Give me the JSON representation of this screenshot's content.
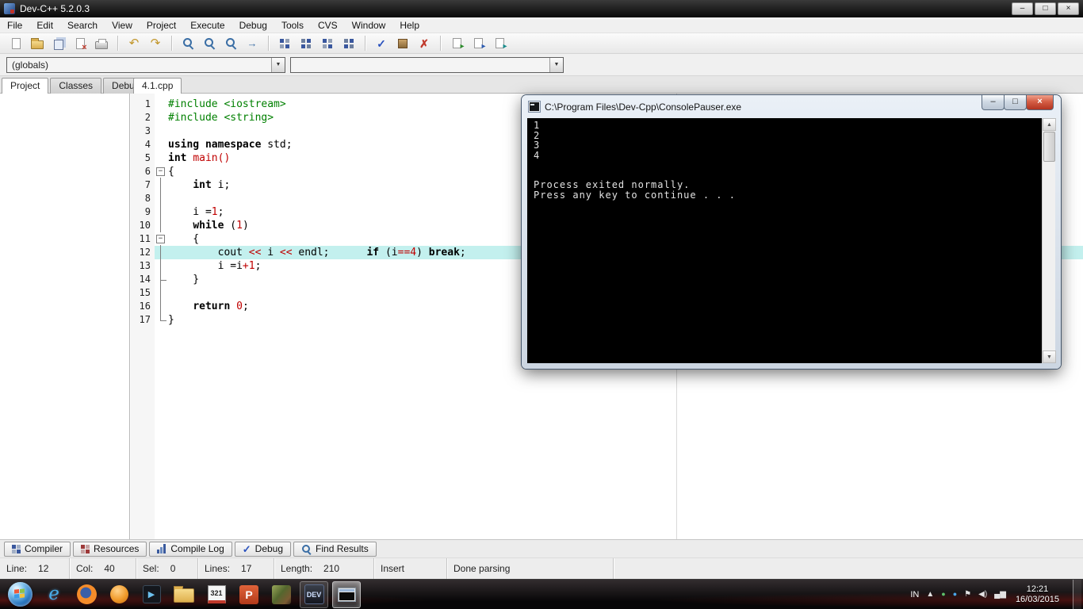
{
  "titlebar": {
    "title": "Dev-C++ 5.2.0.3"
  },
  "icons": {
    "minimize": "–",
    "maximize": "□",
    "close": "×",
    "dropdown": "▼",
    "scroll_up": "▲",
    "scroll_down": "▼",
    "undo": "↶",
    "redo": "↷",
    "check": "✓",
    "abort": "✗",
    "goto_line": "→",
    "fold_collapsed": "−",
    "play": "▶",
    "tray_chevron": "▲",
    "tray_volume": "◀)",
    "tray_network": "▄▆",
    "tray_flag": "⚑",
    "tray_dot": "●"
  },
  "menu": [
    "File",
    "Edit",
    "Search",
    "View",
    "Project",
    "Execute",
    "Debug",
    "Tools",
    "CVS",
    "Window",
    "Help"
  ],
  "navbar": {
    "globals": "(globals)",
    "members": ""
  },
  "panel_tabs": [
    "Project",
    "Classes",
    "Debug"
  ],
  "editor": {
    "tab": "4.1.cpp",
    "lines": [
      {
        "n": 1,
        "fold": "",
        "hl": false,
        "seg": [
          [
            "#include <iostream>",
            "g"
          ]
        ]
      },
      {
        "n": 2,
        "fold": "",
        "hl": false,
        "seg": [
          [
            "#include <string>",
            "g"
          ]
        ]
      },
      {
        "n": 3,
        "fold": "",
        "hl": false,
        "seg": []
      },
      {
        "n": 4,
        "fold": "",
        "hl": false,
        "seg": [
          [
            "using namespace",
            "k"
          ],
          [
            " std;",
            "p"
          ]
        ]
      },
      {
        "n": 5,
        "fold": "",
        "hl": false,
        "seg": [
          [
            "int",
            "k"
          ],
          [
            " ",
            "p"
          ],
          [
            "main()",
            "r"
          ]
        ]
      },
      {
        "n": 6,
        "fold": "box",
        "hl": false,
        "seg": [
          [
            "{",
            "p"
          ]
        ]
      },
      {
        "n": 7,
        "fold": "v",
        "hl": false,
        "seg": [
          [
            "    ",
            "p"
          ],
          [
            "int",
            "k"
          ],
          [
            " i;",
            "p"
          ]
        ]
      },
      {
        "n": 8,
        "fold": "v",
        "hl": false,
        "seg": []
      },
      {
        "n": 9,
        "fold": "v",
        "hl": false,
        "seg": [
          [
            "    i =",
            "p"
          ],
          [
            "1",
            "r"
          ],
          [
            ";",
            "p"
          ]
        ]
      },
      {
        "n": 10,
        "fold": "v",
        "hl": false,
        "seg": [
          [
            "    ",
            "p"
          ],
          [
            "while",
            "k"
          ],
          [
            " (",
            "p"
          ],
          [
            "1",
            "r"
          ],
          [
            ")",
            "p"
          ]
        ]
      },
      {
        "n": 11,
        "fold": "box",
        "hl": false,
        "seg": [
          [
            "    {",
            "p"
          ]
        ]
      },
      {
        "n": 12,
        "fold": "v",
        "hl": true,
        "seg": [
          [
            "        cout ",
            "p"
          ],
          [
            "<<",
            "r"
          ],
          [
            " i ",
            "p"
          ],
          [
            "<<",
            "r"
          ],
          [
            " endl;",
            "p"
          ],
          [
            "      ",
            "p"
          ],
          [
            "if",
            "k"
          ],
          [
            " (i",
            "p"
          ],
          [
            "==",
            "r"
          ],
          [
            "4",
            "r"
          ],
          [
            ") ",
            "p"
          ],
          [
            "break",
            "k"
          ],
          [
            ";",
            "p"
          ]
        ]
      },
      {
        "n": 13,
        "fold": "v",
        "hl": false,
        "seg": [
          [
            "        i =i",
            "p"
          ],
          [
            "+",
            "r"
          ],
          [
            "1",
            "r"
          ],
          [
            ";",
            "p"
          ]
        ]
      },
      {
        "n": 14,
        "fold": "cornerv",
        "hl": false,
        "seg": [
          [
            "    }",
            "p"
          ]
        ]
      },
      {
        "n": 15,
        "fold": "v",
        "hl": false,
        "seg": []
      },
      {
        "n": 16,
        "fold": "v",
        "hl": false,
        "seg": [
          [
            "    ",
            "p"
          ],
          [
            "return",
            "k"
          ],
          [
            " ",
            "p"
          ],
          [
            "0",
            "r"
          ],
          [
            ";",
            "p"
          ]
        ]
      },
      {
        "n": 17,
        "fold": "corner",
        "hl": false,
        "seg": [
          [
            "}",
            "p"
          ]
        ]
      }
    ]
  },
  "console": {
    "title": "C:\\Program Files\\Dev-Cpp\\ConsolePauser.exe",
    "lines": [
      "1",
      "2",
      "3",
      "4",
      "",
      "",
      "Process exited normally.",
      "Press any key to continue . . ."
    ]
  },
  "bottom_tabs": [
    {
      "label": "Compiler",
      "icon": "compiler-grid-icon"
    },
    {
      "label": "Resources",
      "icon": "resources-grid-icon"
    },
    {
      "label": "Compile Log",
      "icon": "compile-log-chart-icon"
    },
    {
      "label": "Debug",
      "icon": "debug-check-icon"
    },
    {
      "label": "Find Results",
      "icon": "find-results-icon"
    }
  ],
  "statusbar": [
    {
      "name": "line",
      "label": "Line:",
      "value": "12"
    },
    {
      "name": "col",
      "label": "Col:",
      "value": "40"
    },
    {
      "name": "sel",
      "label": "Sel:",
      "value": "0"
    },
    {
      "name": "lines",
      "label": "Lines:",
      "value": "17"
    },
    {
      "name": "length",
      "label": "Length:",
      "value": "210"
    },
    {
      "name": "mode",
      "label": "Insert",
      "value": ""
    },
    {
      "name": "parse",
      "label": "Done parsing",
      "value": ""
    }
  ],
  "taskbar": {
    "apps": [
      {
        "icon": "internet-explorer-icon",
        "text": "e"
      },
      {
        "icon": "firefox-icon"
      },
      {
        "icon": "round-orange-icon"
      },
      {
        "icon": "media-player-icon",
        "text": "▶"
      },
      {
        "icon": "folder-icon"
      },
      {
        "icon": "calendar-321-icon",
        "text": "321"
      },
      {
        "icon": "powerpoint-icon",
        "text": "P"
      },
      {
        "icon": "picture-app-icon"
      },
      {
        "icon": "devcpp-icon",
        "text": "DEV",
        "running": true
      },
      {
        "icon": "console-window-icon",
        "active": true
      }
    ],
    "tray": {
      "lang": "IN",
      "time": "12:21",
      "date": "16/03/2015"
    }
  }
}
